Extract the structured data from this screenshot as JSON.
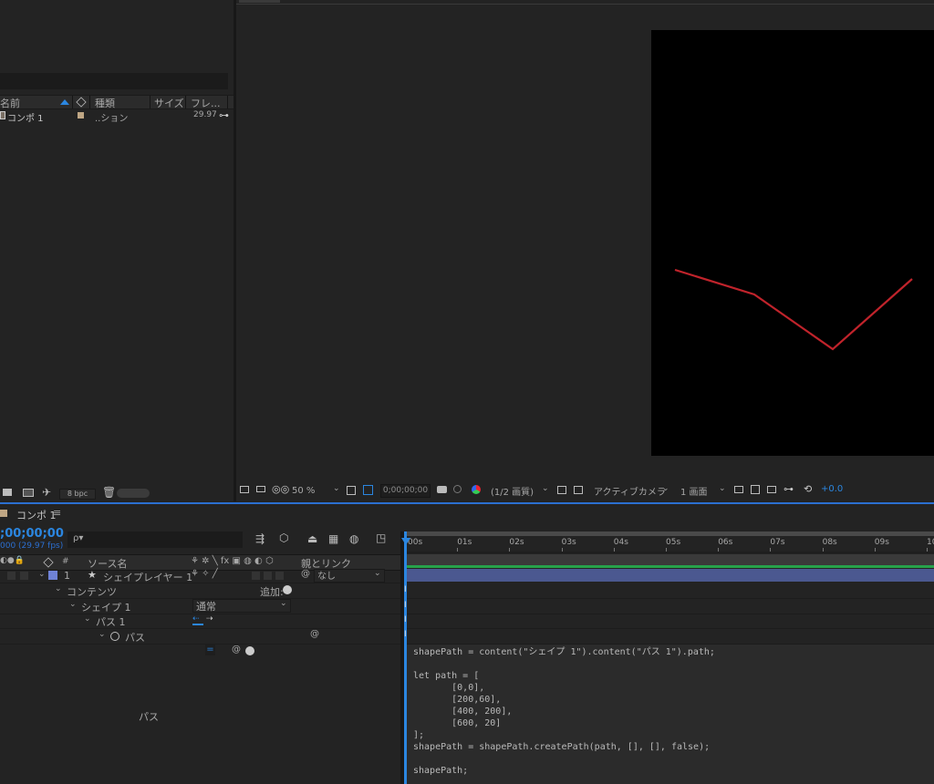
{
  "project": {
    "search_dropdown_arrow": "▾",
    "columns": {
      "name": "名前",
      "type": "種類",
      "size": "サイズ",
      "fps": "フレ..."
    },
    "item": {
      "name": "コンポ 1",
      "type": "..ション",
      "fps": "29.97",
      "label_color": "#bfa684"
    },
    "footer": {
      "bpc": "8 bpc"
    }
  },
  "viewer": {
    "zoom": "50 %",
    "timecode": "0;00;00;00",
    "resolution": "(1/2 画質)",
    "camera": "アクティブカメラ",
    "views": "1 画面",
    "exposure": "+0.0",
    "path_color": "#c0232b"
  },
  "timeline": {
    "tab_title": "コンポ 1",
    "tab_menu": "≡",
    "current_time": ";00;00;00",
    "fps_label": "000 (29.97 fps)",
    "search_placeholder": "ρ▾",
    "ruler_ticks": [
      ":00s",
      "01s",
      "02s",
      "03s",
      "04s",
      "05s",
      "06s",
      "07s",
      "08s",
      "09s",
      "10"
    ],
    "header": {
      "num": "#",
      "source_name": "ソース名",
      "parent": "親とリンク"
    },
    "layer": {
      "index": "1",
      "name": "シェイプレイヤー 1",
      "parent_value": "なし",
      "label_color": "#6f82d6"
    },
    "contents_label": "コンテンツ",
    "add_label": "追加:",
    "shape_label": "シェイプ 1",
    "blend_mode": "通常",
    "path_group_label": "パス 1",
    "path_prop_label": "パス",
    "expression_label": "パス",
    "expression_lines": [
      "shapePath = content(\"シェイプ 1\").content(\"パス 1\").path;",
      "",
      "let path = [",
      "       [0,0],",
      "       [200,60],",
      "       [400, 200],",
      "       [600, 20]",
      "];",
      "shapePath = shapePath.createPath(path, [], [], false);",
      "",
      "shapePath;"
    ]
  }
}
